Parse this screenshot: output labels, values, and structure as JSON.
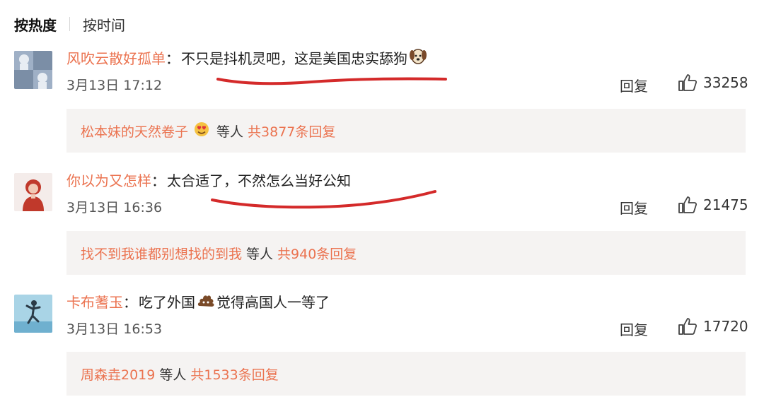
{
  "sort": {
    "hot_label": "按热度",
    "time_label": "按时间"
  },
  "colors": {
    "username": "#eb7350",
    "underline": "#d42a2a",
    "reply_bg": "#f5f3f2"
  },
  "comments": [
    {
      "username": "风吹云散好孤单",
      "colon": "：",
      "text": "不只是抖机灵吧，这是美国忠实舔狗",
      "emoji": "dog-face-emoji",
      "timestamp": "3月13日 17:12",
      "reply_label": "回复",
      "likes": "33258",
      "reply_users": "松本妹的天然卷子",
      "reply_emoji": "heart-eyes-emoji",
      "reply_etc": "等人",
      "reply_total": "共3877条回复"
    },
    {
      "username": "你以为又怎样",
      "colon": "：",
      "text": "太合适了，不然怎么当好公知",
      "timestamp": "3月13日 16:36",
      "reply_label": "回复",
      "likes": "21475",
      "reply_users": "找不到我谁都别想找的到我",
      "reply_etc": "等人",
      "reply_total": "共940条回复"
    },
    {
      "username": "卡布蓍玉",
      "colon": "：",
      "text_before": "吃了外国",
      "emoji": "poop-emoji",
      "text_after": "觉得高国人一等了",
      "timestamp": "3月13日 16:53",
      "reply_label": "回复",
      "likes": "17720",
      "reply_users": "周森垚2019",
      "reply_etc": "等人",
      "reply_total": "共1533条回复"
    }
  ]
}
